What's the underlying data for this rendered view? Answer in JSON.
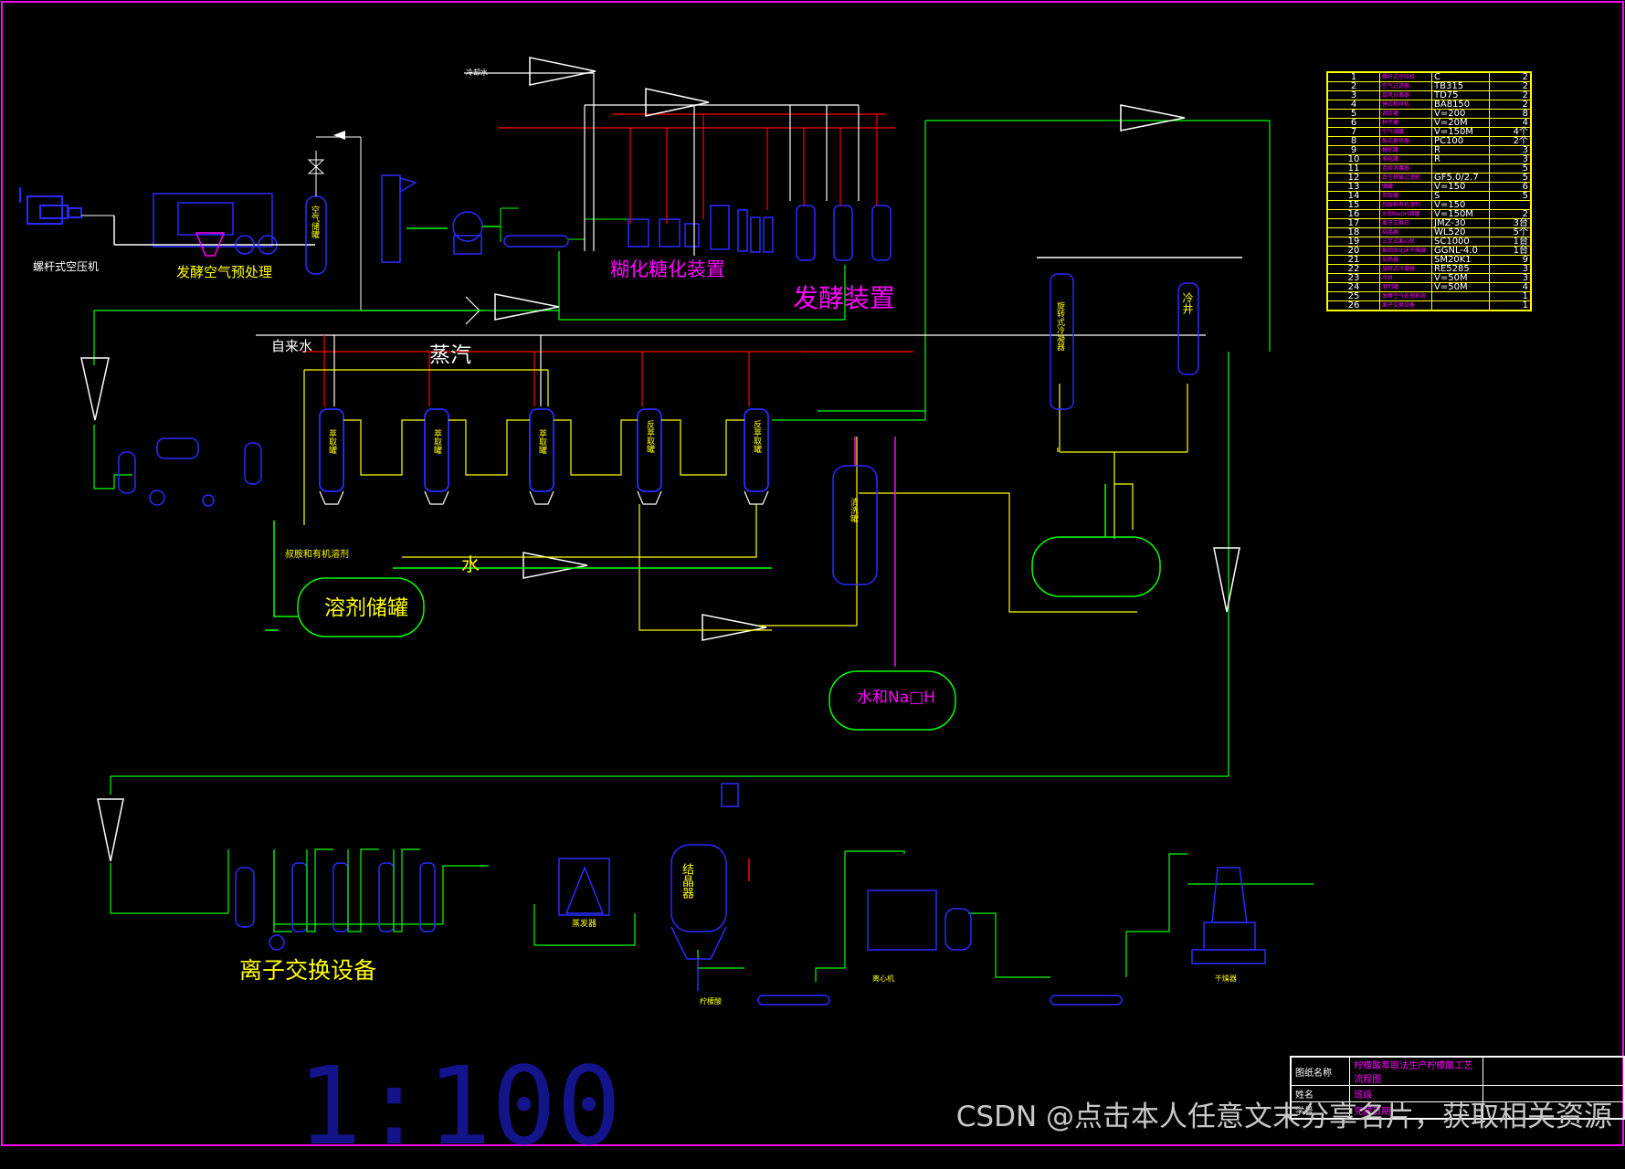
{
  "labels": {
    "air_compressor": "螺杆式空压机",
    "air_pretreat": "发酵空气预处理",
    "liquefaction": "糊化糖化装置",
    "fermentation": "发酵装置",
    "tap_water": "自来水",
    "steam": "蒸汽",
    "solvent_tank": "溶剂储罐",
    "water": "水",
    "ion_exchange": "离子交换设备",
    "naoh_tank": "水和Na□H",
    "crystallizer": "结晶器",
    "evaporator": "蒸发器",
    "centrifuge": "离心机",
    "dryer": "干燥器",
    "scale": "1:100",
    "cooling_well": "冷井",
    "top_left_tag": "冷却水",
    "amine_tag": "叔胺和有机溶剂",
    "citrate_pump": "柠檬酸",
    "air_tank": "空气储罐",
    "column_text": "萃取罐",
    "back_text": "反萃取罐",
    "clarifier": "清洗罐",
    "heat_ex": "旋转式冷凝器"
  },
  "bom": [
    {
      "n": "1",
      "d": "螺杆式空压机",
      "s": "C",
      "q": "2"
    },
    {
      "n": "2",
      "d": "空气过滤器",
      "s": "TB315",
      "q": "2"
    },
    {
      "n": "3",
      "d": "旋风分离器",
      "s": "TD75",
      "q": "2"
    },
    {
      "n": "4",
      "d": "锤式粉碎机",
      "s": "BA8150",
      "q": "2"
    },
    {
      "n": "5",
      "d": "调浆罐",
      "s": "V=200",
      "q": "8"
    },
    {
      "n": "6",
      "d": "种子罐",
      "s": "V=20M",
      "q": "4"
    },
    {
      "n": "7",
      "d": "空气储罐",
      "s": "V=150M",
      "q": "4个"
    },
    {
      "n": "8",
      "d": "板式换热器",
      "s": "PC100",
      "q": "2个"
    },
    {
      "n": "9",
      "d": "糖化罐",
      "s": "R",
      "q": "3"
    },
    {
      "n": "10",
      "d": "液化罐",
      "s": "R",
      "q": "3"
    },
    {
      "n": "11",
      "d": "连续消毒器",
      "s": "",
      "q": "5"
    },
    {
      "n": "12",
      "d": "真空转鼓过滤机",
      "s": "GF5.0/2.7",
      "q": "5"
    },
    {
      "n": "13",
      "d": "储罐",
      "s": "V=150",
      "q": "6"
    },
    {
      "n": "14",
      "d": "萃取罐",
      "s": "S",
      "q": "5"
    },
    {
      "n": "15",
      "d": "叔胺和有机溶剂",
      "s": "V=150",
      "q": ""
    },
    {
      "n": "16",
      "d": "水和NaOH储罐",
      "s": "V=150M",
      "q": "2"
    },
    {
      "n": "17",
      "d": "离子交换柱",
      "s": "JMZ-30",
      "q": "3台"
    },
    {
      "n": "18",
      "d": "结晶器",
      "s": "WL520",
      "q": "5个"
    },
    {
      "n": "19",
      "d": "三足式离心机",
      "s": "SC1000",
      "q": "1台"
    },
    {
      "n": "20",
      "d": "振动流化床干燥器",
      "s": "GGNL-4.0",
      "q": "1台"
    },
    {
      "n": "21",
      "d": "加热器",
      "s": "SM20K1",
      "q": "9"
    },
    {
      "n": "22",
      "d": "旋转式冷凝器",
      "s": "RE5285",
      "q": "3"
    },
    {
      "n": "23",
      "d": "冷井",
      "s": "V=50M",
      "q": "3"
    },
    {
      "n": "24",
      "d": "溶剂罐",
      "s": "V=50M",
      "q": "4"
    },
    {
      "n": "25",
      "d": "发酵空气处理系统",
      "s": "",
      "q": "1"
    },
    {
      "n": "26",
      "d": "离子交换设备",
      "s": "",
      "q": "1"
    }
  ],
  "title_block": {
    "r1c1": "图纸名称",
    "r1c2": "柠檬酸萃取法生产柠檬酸工艺流程图",
    "r2c1": "姓名",
    "r2c2": "班级",
    "r3c1": "学号",
    "r3c2": "完成日期"
  },
  "watermark": "CSDN @点击本人任意文末分享名片，获取相关资源",
  "colors": {
    "bg": "#000000",
    "green": "#00ff00",
    "yellow": "#ffff00",
    "white": "#ffffff",
    "red": "#ff0000",
    "magenta": "#ff00ff",
    "blue": "#2a2aff",
    "scale": "#1a1a8a"
  }
}
